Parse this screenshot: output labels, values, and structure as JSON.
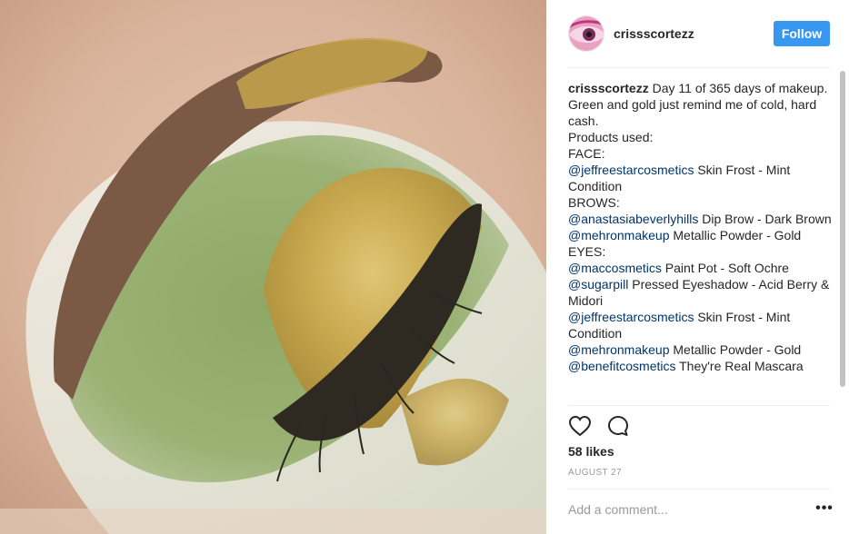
{
  "post": {
    "image_alt": "eye makeup photo",
    "username": "crissscortezz",
    "follow_label": "Follow",
    "caption": {
      "username": "crissscortezz",
      "lines": [
        {
          "text": "Day 11 of 365 days of makeup."
        },
        {
          "text": "Green and gold just remind me of cold, hard cash."
        },
        {
          "text": "Products used:"
        },
        {
          "text": "FACE:"
        },
        {
          "mention": "@jeffreestarcosmetics",
          "text": " Skin Frost - Mint Condition"
        },
        {
          "text": "BROWS:"
        },
        {
          "mention": "@anastasiabeverlyhills",
          "text": " Dip Brow - Dark Brown"
        },
        {
          "mention": "@mehronmakeup",
          "text": " Metallic Powder - Gold"
        },
        {
          "text": "EYES:"
        },
        {
          "mention": "@maccosmetics",
          "text": " Paint Pot - Soft Ochre"
        },
        {
          "mention": "@sugarpill",
          "text": " Pressed Eyeshadow - Acid Berry & Midori"
        },
        {
          "mention": "@jeffreestarcosmetics",
          "text": " Skin Frost - Mint Condition"
        },
        {
          "mention": "@mehronmakeup",
          "text": " Metallic Powder - Gold"
        },
        {
          "mention": "@benefitcosmetics",
          "text": " They're Real Mascara"
        }
      ]
    },
    "likes": "58 likes",
    "date": "AUGUST 27",
    "comment_placeholder": "Add a comment...",
    "more_label": "•••",
    "icons": {
      "like": "heart-icon",
      "comment": "comment-icon",
      "more": "more-options-icon"
    },
    "colors": {
      "follow": "#3897f0",
      "mention": "#003569",
      "muted": "#999999",
      "text": "#262626"
    }
  }
}
